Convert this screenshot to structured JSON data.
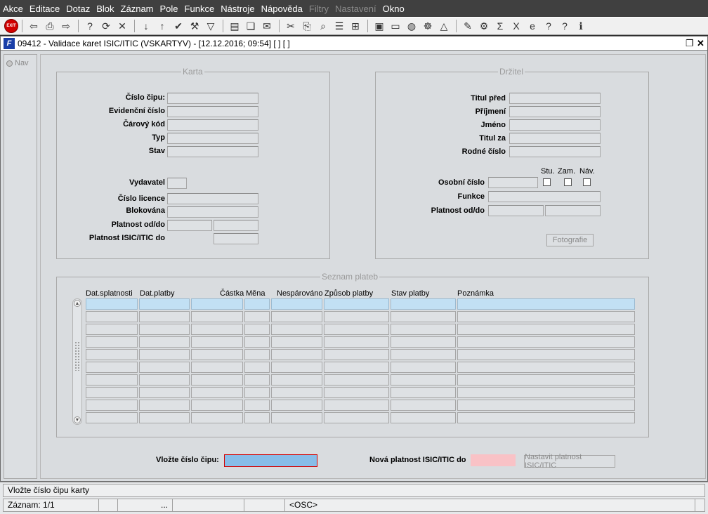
{
  "menu": [
    {
      "label": "Akce",
      "enabled": true
    },
    {
      "label": "Editace",
      "enabled": true
    },
    {
      "label": "Dotaz",
      "enabled": true
    },
    {
      "label": "Blok",
      "enabled": true
    },
    {
      "label": "Záznam",
      "enabled": true
    },
    {
      "label": "Pole",
      "enabled": true
    },
    {
      "label": "Funkce",
      "enabled": true
    },
    {
      "label": "Nástroje",
      "enabled": true
    },
    {
      "label": "Nápověda",
      "enabled": true
    },
    {
      "label": "Filtry",
      "enabled": false
    },
    {
      "label": "Nastavení",
      "enabled": false
    },
    {
      "label": "Okno",
      "enabled": true
    }
  ],
  "toolbar": {
    "exit_label": "EXIT",
    "groups": [
      [
        {
          "icon": "save-icon",
          "glyph": "⇦"
        },
        {
          "icon": "print-icon",
          "glyph": "⎙"
        },
        {
          "icon": "clear-icon",
          "glyph": "⇨"
        }
      ],
      [
        {
          "icon": "query-icon",
          "glyph": "?"
        },
        {
          "icon": "query-execute-icon",
          "glyph": "⟳"
        },
        {
          "icon": "query-cancel-icon",
          "glyph": "✕"
        }
      ],
      [
        {
          "icon": "sort-asc-icon",
          "glyph": "↓"
        },
        {
          "icon": "sort-desc-icon",
          "glyph": "↑"
        },
        {
          "icon": "commit-icon",
          "glyph": "✔"
        },
        {
          "icon": "settings-icon",
          "glyph": "⚒"
        },
        {
          "icon": "filter-icon",
          "glyph": "▽"
        }
      ],
      [
        {
          "icon": "document-icon",
          "glyph": "▤"
        },
        {
          "icon": "attachment-icon",
          "glyph": "❏"
        },
        {
          "icon": "mail-icon",
          "glyph": "✉"
        }
      ],
      [
        {
          "icon": "cut-icon",
          "glyph": "✂"
        },
        {
          "icon": "copy-icon",
          "glyph": "⎘"
        },
        {
          "icon": "search-icon",
          "glyph": "⌕"
        },
        {
          "icon": "list-icon",
          "glyph": "☰"
        },
        {
          "icon": "tree-icon",
          "glyph": "⊞"
        }
      ],
      [
        {
          "icon": "paste-icon",
          "glyph": "▣"
        },
        {
          "icon": "record-icon",
          "glyph": "▭"
        },
        {
          "icon": "globe-icon",
          "glyph": "◍"
        },
        {
          "icon": "navigation-icon",
          "glyph": "☸"
        },
        {
          "icon": "warning-icon",
          "glyph": "△"
        }
      ],
      [
        {
          "icon": "edit-icon",
          "glyph": "✎"
        },
        {
          "icon": "tools-icon",
          "glyph": "⚙"
        },
        {
          "icon": "sum-icon",
          "glyph": "Σ"
        },
        {
          "icon": "excel-icon",
          "glyph": "X"
        },
        {
          "icon": "internet-icon",
          "glyph": "e"
        },
        {
          "icon": "help-context-icon",
          "glyph": "?"
        },
        {
          "icon": "help-icon",
          "glyph": "?"
        },
        {
          "icon": "info-icon",
          "glyph": "ℹ"
        }
      ]
    ]
  },
  "window": {
    "title": "09412 - Validace karet ISIC/ITIC (VSKARTYV) - [12.12.2016; 09:54]  [ ] [ ]",
    "restore_glyph": "❐",
    "close_glyph": "✕"
  },
  "nav": {
    "label": "Nav"
  },
  "karta": {
    "title": "Karta",
    "cislo_cipu": "Číslo čipu:",
    "evidencni_cislo": "Evidenční číslo",
    "carovy_kod": "Čárový kód",
    "typ": "Typ",
    "stav": "Stav",
    "vydavatel": "Vydavatel",
    "cislo_licence": "Číslo licence",
    "blokovana": "Blokována",
    "platnost": "Platnost od/do",
    "platnost_isic": "Platnost ISIC/ITIC do"
  },
  "drzitel": {
    "title": "Držitel",
    "titul_pred": "Titul před",
    "prijmeni": "Příjmení",
    "jmeno": "Jméno",
    "titul_za": "Titul za",
    "rodne_cislo": "Rodné číslo",
    "stu": "Stu.",
    "zam": "Zam.",
    "nav": "Náv.",
    "osobni_cislo": "Osobní číslo",
    "funkce": "Funkce",
    "platnost": "Platnost od/do",
    "fotografie_button": "Fotografie"
  },
  "platby": {
    "title": "Seznam plateb",
    "columns": [
      "Dat.splatnosti",
      "Dat.platby",
      "Částka",
      "Měna",
      "Nespárováno",
      "Způsob platby",
      "Stav platby",
      "Poznámka"
    ],
    "row_count": 10
  },
  "bottom": {
    "vlozte_label": "Vložte číslo čipu:",
    "nova_platnost_label": "Nová platnost ISIC/ITIC do",
    "nastavit_button": "Nastavit platnost ISIC/ITIC"
  },
  "colors": {
    "required_field": "#87bde8",
    "required_border": "#d40000",
    "pink_field": "#f9c2c6",
    "current_row": "#c2e0f4"
  },
  "status": {
    "message": "Vložte číslo čipu karty",
    "record": "Záznam: 1/1",
    "segment_more": "...",
    "mode": "<OSC>"
  }
}
